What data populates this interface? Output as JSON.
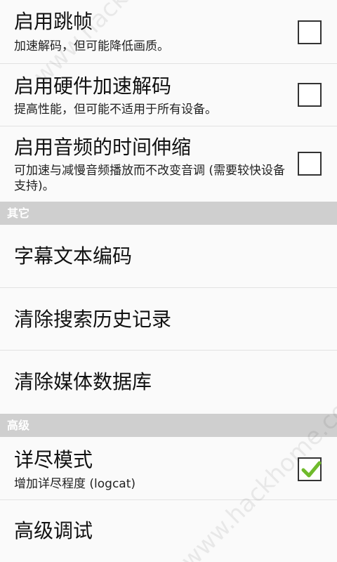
{
  "prefs": {
    "frame_skip": {
      "title": "启用跳帧",
      "summary": "加速解码，但可能降低画质。",
      "checked": false
    },
    "hw_decode": {
      "title": "启用硬件加速解码",
      "summary": "提高性能，但可能不适用于所有设备。",
      "checked": false
    },
    "time_stretch": {
      "title": "启用音频的时间伸缩",
      "summary": "可加速与减慢音频播放而不改变音调 (需要较快设备支持)。",
      "checked": false
    }
  },
  "categories": {
    "other": "其它",
    "advanced": "高级"
  },
  "other_items": {
    "subtitle_encoding": "字幕文本编码",
    "clear_search_history": "清除搜索历史记录",
    "clear_media_db": "清除媒体数据库"
  },
  "advanced_items": {
    "verbose": {
      "title": "详尽模式",
      "summary": "增加详尽程度 (logcat)",
      "checked": true
    },
    "advanced_debug": "高级调试"
  },
  "watermarks": {
    "text": "www.hackhome.com"
  },
  "colors": {
    "category_bg": "#cfcfcf",
    "check_green": "#6fba2c",
    "divider": "#e2e2e2"
  }
}
